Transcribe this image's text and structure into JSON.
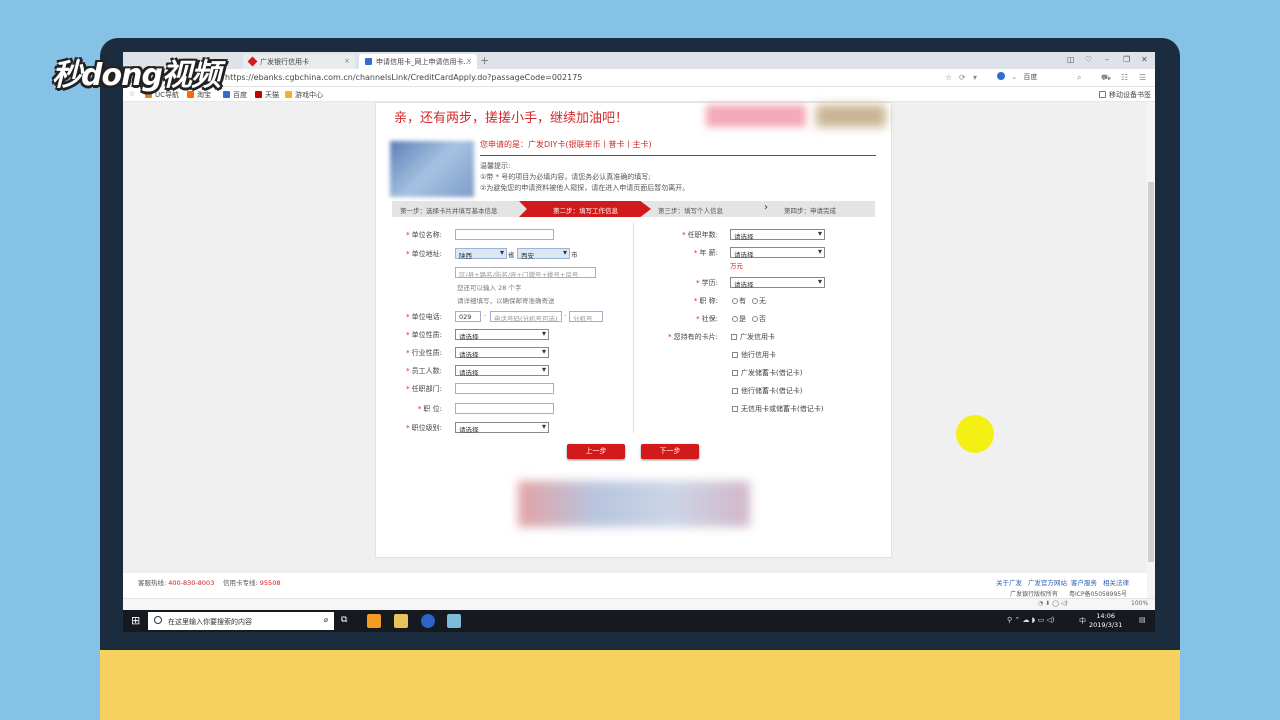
{
  "watermark": "秒dong视频",
  "browser": {
    "tabs": [
      {
        "label": "广发银行信用卡"
      },
      {
        "label": "申请信用卡_网上申请信用卡…"
      }
    ],
    "url": "https://ebanks.cgbchina.com.cn/channelsLink/CreditCardApply.do?passageCode=002175",
    "search_engine": "百度",
    "bookmarks": [
      "UC导航",
      "淘宝",
      "百度",
      "天猫",
      "游戏中心"
    ],
    "sync_label": "移动设备书签"
  },
  "page": {
    "headline": "亲，还有两步，搓搓小手，继续加油吧！",
    "apply_text": "您申请的是：广发DIY卡(银联单币丨普卡丨主卡)",
    "tips": [
      "温馨提示:",
      "①带 * 号的项目为必填内容，请您务必认真准确的填写;",
      "②为避免您的申请资料被他人窥探，请在进入申请页面后暂勿离开。"
    ],
    "steps": [
      "第一步：选择卡片并填写基本信息",
      "第二步：填写工作信息",
      "第三步：填写个人信息",
      "第四步：申请完成"
    ],
    "left_form": {
      "company_name": "单位名称:",
      "company_address": "单位地址:",
      "province": "陕西",
      "province_unit": "省",
      "city": "西安",
      "city_unit": "市",
      "address_placeholder": "区/县+路名/街名/弄+门牌号+楼号+房号",
      "address_hint1": "您还可以输入 28 个字",
      "address_hint2": "请详细填写，以确保邮寄准确寄送",
      "company_phone": "单位电话:",
      "area_code": "029",
      "phone_placeholder": "电话号码(分机号可选)",
      "ext_placeholder": "分机号",
      "company_type": "单位性质:",
      "industry": "行业性质:",
      "employees": "员工人数:",
      "department": "任职部门:",
      "position": "职 位:",
      "position_level": "职位级别:",
      "select_placeholder": "请选择"
    },
    "right_form": {
      "years": "任职年数:",
      "salary": "年 薪:",
      "salary_unit": "万元",
      "education": "学历:",
      "title": "职 称:",
      "title_yes": "有",
      "title_no": "无",
      "social": "社保:",
      "social_yes": "是",
      "social_no": "否",
      "cards": "您持有的卡片:",
      "card_options": [
        "广发信用卡",
        "他行信用卡",
        "广发储蓄卡(借记卡)",
        "他行储蓄卡(借记卡)",
        "无信用卡或储蓄卡(借记卡)"
      ],
      "select_placeholder": "请选择"
    },
    "buttons": {
      "prev": "上一步",
      "next": "下一步"
    }
  },
  "footer": {
    "hotline_label": "客服热线:",
    "hotline": "400-830-8003",
    "card_line_label": "信用卡专线:",
    "card_line": "95508",
    "links": [
      "关于广发",
      "广发官方网站",
      "客户服务",
      "相关法律"
    ],
    "copyright": "广发银行版权所有",
    "icp": "粤ICP备05058995号"
  },
  "taskbar": {
    "search_placeholder": "在这里输入你要搜索的内容",
    "time": "14:06",
    "date": "2019/3/31",
    "ime": "中",
    "zoom": "100%"
  }
}
